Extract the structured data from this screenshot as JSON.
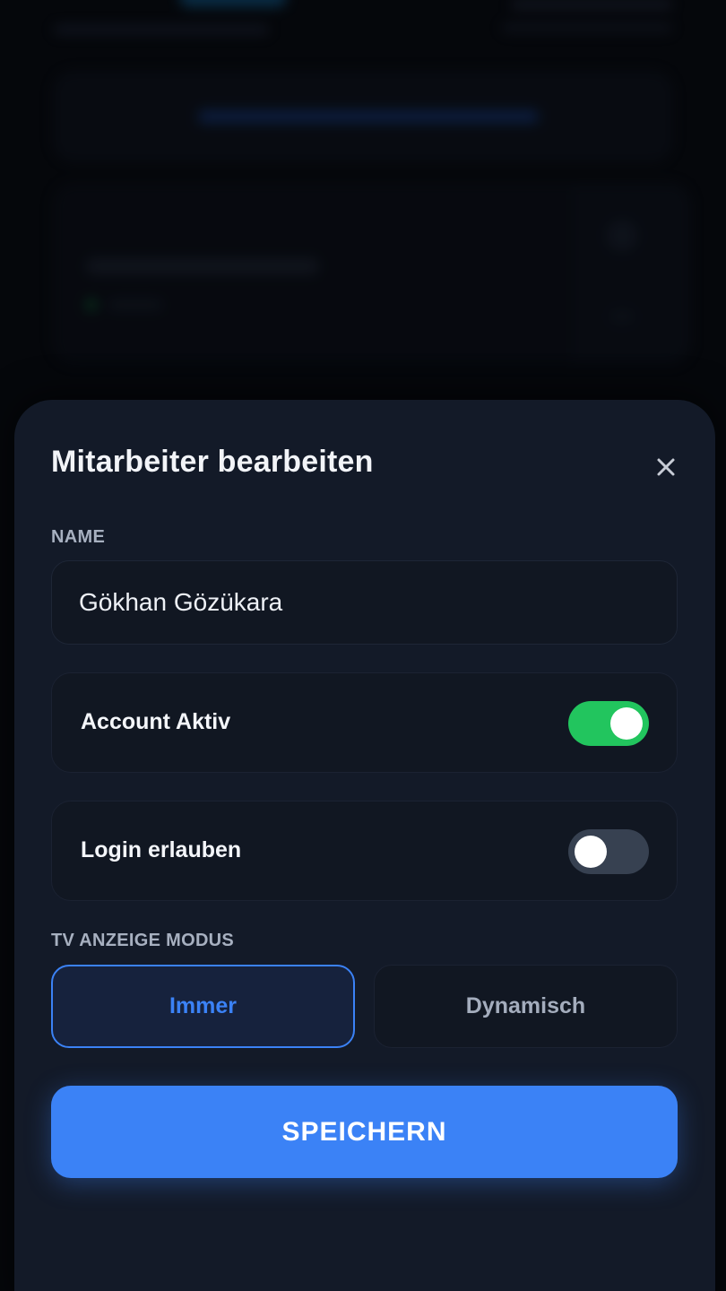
{
  "modal": {
    "title": "Mitarbeiter bearbeiten",
    "close_icon": "close-icon",
    "name_label": "NAME",
    "name_value": "Gökhan Gözükara",
    "account_active": {
      "label": "Account Aktiv",
      "enabled": true
    },
    "login_allowed": {
      "label": "Login erlauben",
      "enabled": false
    },
    "tv_mode": {
      "label": "TV ANZEIGE MODUS",
      "options": [
        "Immer",
        "Dynamisch"
      ],
      "selected": "Immer"
    },
    "save_label": "SPEICHERN"
  },
  "colors": {
    "accent": "#3b82f6",
    "toggle_on": "#22c55e",
    "toggle_off": "#374151",
    "sheet_bg": "#131a28",
    "field_bg": "#111722"
  }
}
